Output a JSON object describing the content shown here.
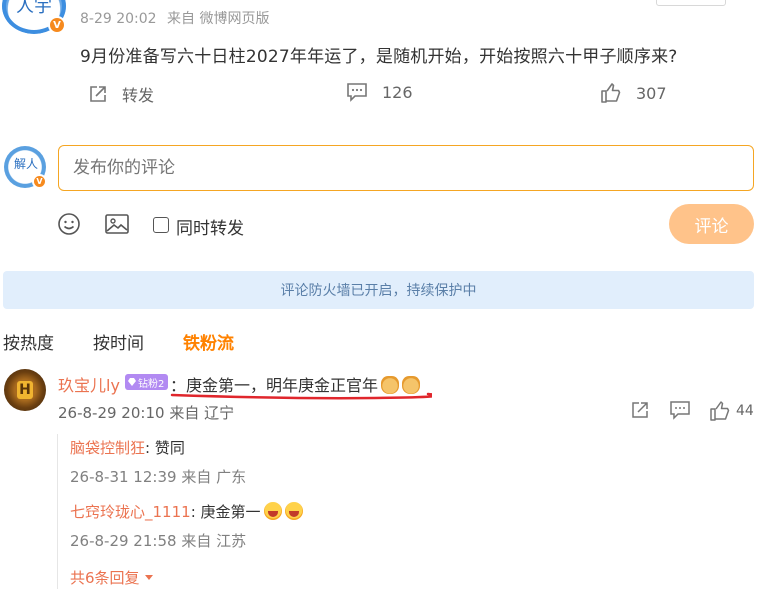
{
  "post": {
    "author_badge": "V",
    "meta": {
      "time": "8-29 20:02",
      "source": "来自 微博网页版"
    },
    "text": "9月份准备写六十日柱2027年年运了，是随机开始，开始按照六十甲子顺序来?",
    "actions": {
      "repost_label": "转发",
      "comment_count": "126",
      "like_count": "307"
    }
  },
  "composer": {
    "placeholder": "发布你的评论",
    "repost_checkbox_label": "同时转发",
    "submit_label": "评论"
  },
  "firewall_notice": "评论防火墙已开启，持续保护中",
  "sort_tabs": [
    {
      "label": "按热度",
      "active": false
    },
    {
      "label": "按时间",
      "active": false
    },
    {
      "label": "铁粉流",
      "active": true
    }
  ],
  "comment": {
    "username": "玖宝儿ly",
    "fan_badge": "钻粉2",
    "text": "：庚金第一，明年庚金正官年",
    "time": "26-8-29 20:10",
    "location": "来自 辽宁",
    "like_count": "44",
    "replies": [
      {
        "username": "脑袋控制狂",
        "text": ": 赞同",
        "time": "26-8-31 12:39",
        "location": "来自 广东"
      },
      {
        "username": "七窍玲珑心_1111",
        "text": ": 庚金第一",
        "time": "26-8-29 21:58",
        "location": "来自 江苏"
      }
    ],
    "more_replies_label": "共6条回复"
  },
  "colors": {
    "accent_orange": "#ff8200",
    "username_orange": "#eb7350",
    "input_border": "#f5a623",
    "submit_bg": "#ffc38a",
    "firewall_bg": "#e1eefc",
    "underline_red": "#e0262c"
  }
}
